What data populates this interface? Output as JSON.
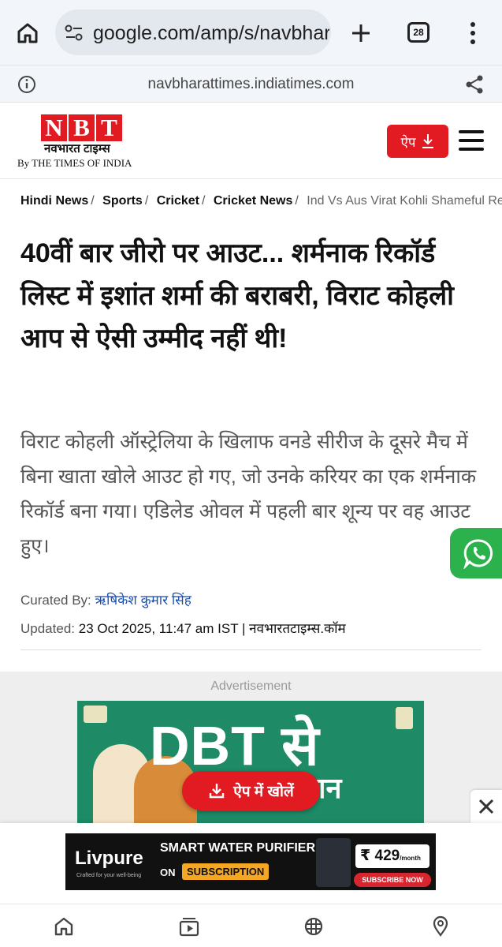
{
  "browser": {
    "url": "google.com/amp/s/navbharatt",
    "tab_count": "28",
    "amp_domain": "navbharattimes.indiatimes.com"
  },
  "header": {
    "logo_letters": [
      "N",
      "B",
      "T"
    ],
    "logo_hindi": "नवभारत टाइम्स",
    "logo_by": "By THE TIMES OF INDIA",
    "app_button": "ऐप"
  },
  "breadcrumb": {
    "items": [
      "Hindi News",
      "Sports",
      "Cricket",
      "Cricket News"
    ],
    "current": "Ind Vs Aus Virat Kohli Shameful Record"
  },
  "article": {
    "headline": "40वीं बार जीरो पर आउट... शर्मनाक रिकॉर्ड लिस्ट में इशांत शर्मा की बराबरी, विराट कोहली आप से ऐसी उम्मीद नहीं थी!",
    "summary": "विराट कोहली ऑस्ट्रेलिया के खिलाफ वनडे सीरीज के दूसरे मैच में बिना खाता खोले आउट हो गए, जो उनके करियर का एक शर्मनाक रिकॉर्ड बना गया। एडिलेड ओवल में पहली बार शून्य पर वह आउट हुए।",
    "curated_label": "Curated By:",
    "curated_by": "ऋषिकेश कुमार सिंह",
    "updated_label": "Updated:",
    "updated_value": "23 Oct 2025, 11:47 am IST | नवभारतटाइम्स.कॉम"
  },
  "ad": {
    "label": "Advertisement",
    "big_text": "DBT से",
    "sub_text": "आसान",
    "open_app": "ऐप में खोलें"
  },
  "sticky_ad": {
    "brand": "Livpure",
    "tagline": "Crafted for your well-being",
    "headline": "SMART WATER PURIFIER",
    "on": "ON",
    "subscription": "SUBSCRIPTION",
    "price": "₹ 429",
    "price_unit": "/month",
    "cta": "SUBSCRIBE NOW"
  },
  "colors": {
    "brand_red": "#e21b23",
    "whatsapp_green": "#2bb24c",
    "link_blue": "#1a4fb3"
  },
  "icons": [
    "home-icon",
    "site-info-icon",
    "plus-icon",
    "tabs-icon",
    "more-icon",
    "info-icon",
    "share-icon",
    "download-icon",
    "menu-icon",
    "whatsapp-icon",
    "close-icon",
    "nav-home-icon",
    "nav-video-icon",
    "nav-web-icon",
    "nav-location-icon"
  ]
}
